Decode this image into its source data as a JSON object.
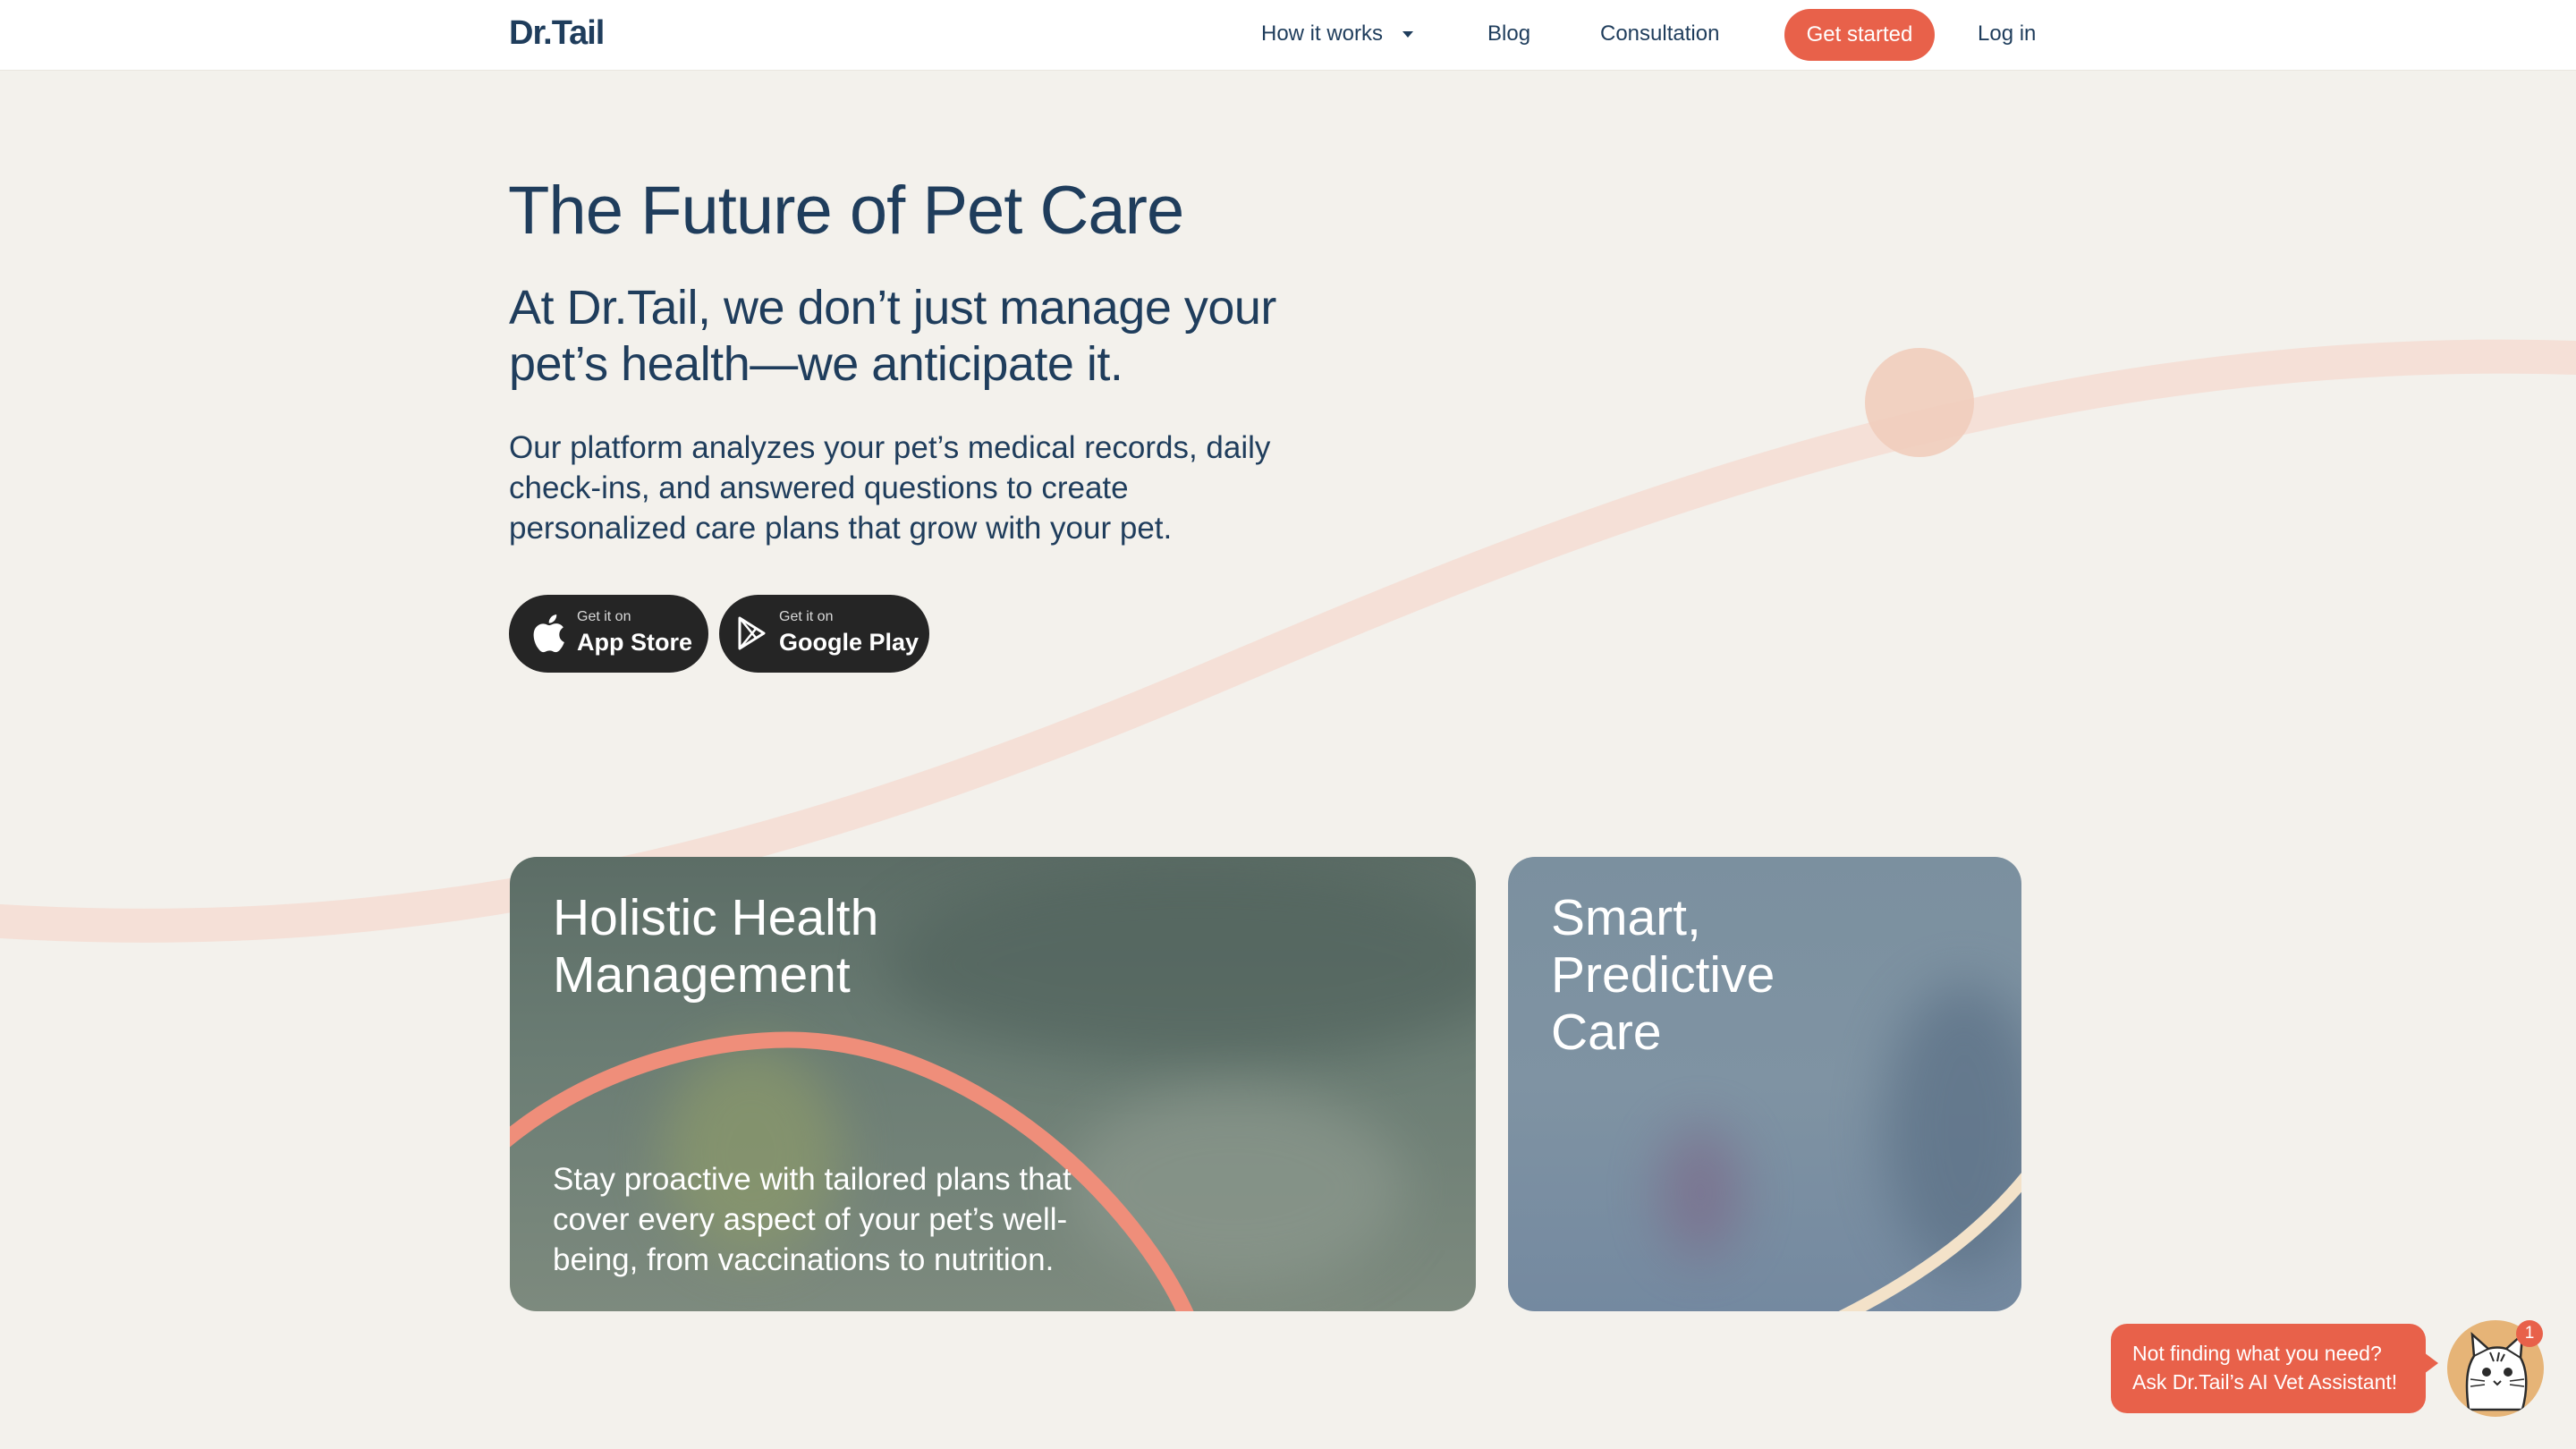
{
  "header": {
    "logo": "Dr.Tail",
    "nav": {
      "how_it_works": "How it works",
      "blog": "Blog",
      "consultation": "Consultation",
      "get_started": "Get started",
      "login": "Log in"
    }
  },
  "hero": {
    "title": "The Future of Pet Care",
    "subtitle": "At Dr.Tail, we don’t just manage your pet’s health—we anticipate it.",
    "body": "Our platform analyzes your pet’s medical records, daily check-ins, and answered questions to create personalized care plans that grow with your pet."
  },
  "stores": [
    {
      "small": "Get it on",
      "big": "App Store",
      "icon": "apple-icon"
    },
    {
      "small": "Get it on",
      "big": "Google Play",
      "icon": "google-play-icon"
    }
  ],
  "cards": [
    {
      "title_lines": [
        "Holistic Health",
        "Management"
      ],
      "text": "Stay proactive with tailored plans that cover every aspect of your pet’s well-being, from vaccinations to nutrition."
    },
    {
      "title_lines": [
        "Smart,",
        "Predictive",
        "Care"
      ]
    }
  ],
  "chat": {
    "line1": "Not finding what you need?",
    "line2": "Ask Dr.Tail’s AI Vet Assistant!",
    "badge": "1",
    "avatar_icon": "cat-avatar-icon"
  },
  "colors": {
    "primary": "#1f3d5c",
    "accent": "#e8614a",
    "background": "#f3f1ec",
    "decor_curve": "#f4ddd3"
  }
}
